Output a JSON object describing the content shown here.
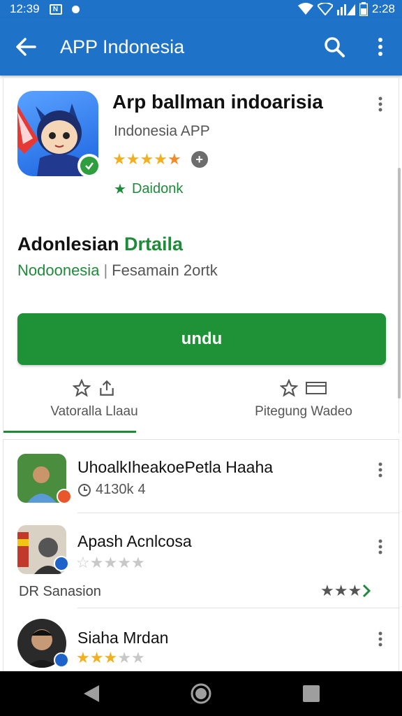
{
  "status_bar": {
    "time_left": "12:39",
    "time_right": "2:28",
    "box_label": "N"
  },
  "app_bar": {
    "title": "APP Indonesia"
  },
  "app": {
    "name": "Arp ballman indoarisia",
    "developer": "Indonesia APP",
    "rating_stars": 4.5,
    "badge_text": "Daidonk",
    "section_title_main": "Adonlesian ",
    "section_title_accent": "Drtaila",
    "subtitle_green": "Nodoonesia",
    "subtitle_sep": "|",
    "subtitle_rest": "Fesamain 2ortk",
    "install_label": "undu"
  },
  "action_tabs": [
    {
      "label": "Vatoralla Llaau"
    },
    {
      "label": "Pitegung Wadeo"
    }
  ],
  "list": [
    {
      "title": "UhoalkIheakoePetla Haaha",
      "meta": "4130k",
      "meta_suffix": "4"
    },
    {
      "title": "Apash Acnlcosa",
      "stars": 0,
      "developer": "DR Sanasion",
      "right_stars": 3
    },
    {
      "title": "Siaha Mrdan",
      "stars": 3
    }
  ],
  "colors": {
    "primary": "#1e73c9",
    "install": "#1f9136",
    "accent_green": "#1f8a3a",
    "star": "#f2b01e"
  }
}
